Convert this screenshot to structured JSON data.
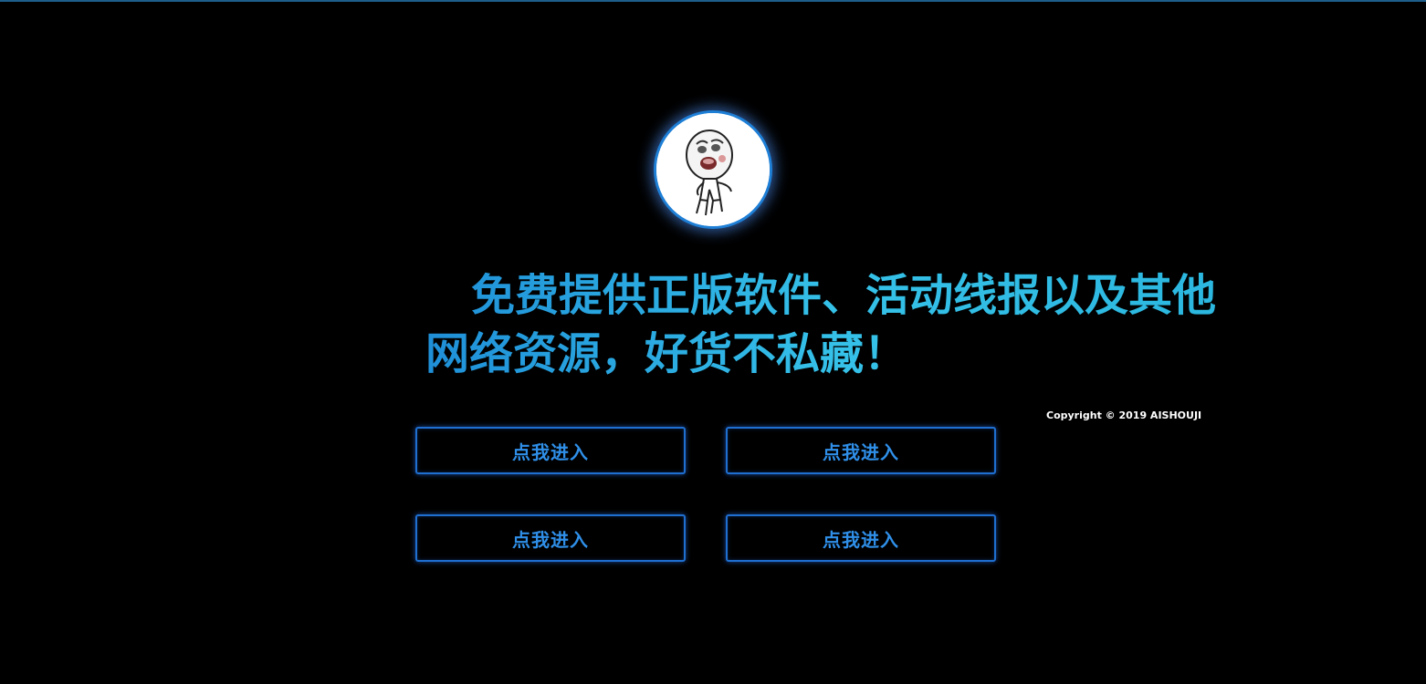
{
  "headline": "免费提供正版软件、活动线报以及其他网络资源，好货不私藏！",
  "copyright": "Copyright © 2019 AISHOUJI",
  "buttons": [
    {
      "label": "点我进入"
    },
    {
      "label": "点我进入"
    },
    {
      "label": "点我进入"
    },
    {
      "label": "点我进入"
    }
  ],
  "colors": {
    "background": "#000000",
    "accent": "#1f6fd0",
    "headline": "#2aa9e0",
    "button_text": "#2f8fe8"
  },
  "avatar": {
    "icon": "meme-face-avatar-icon"
  }
}
